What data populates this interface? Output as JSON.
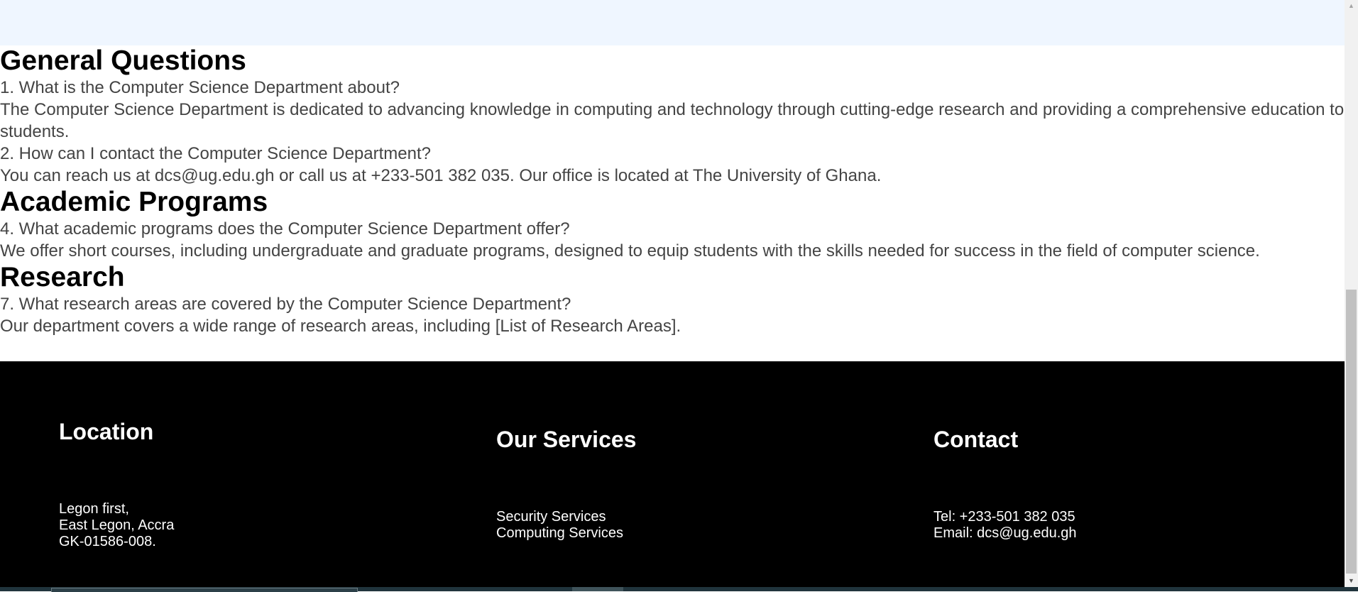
{
  "faq": {
    "sections": [
      {
        "heading": "General Questions",
        "items": [
          {
            "question": "1. What is the Computer Science Department about?",
            "answer": "The Computer Science Department is dedicated to advancing knowledge in computing and technology through cutting-edge research and providing a comprehensive education to students."
          },
          {
            "question": "2. How can I contact the Computer Science Department?",
            "answer": "You can reach us at dcs@ug.edu.gh or call us at +233-501 382 035. Our office is located at The University of Ghana."
          }
        ]
      },
      {
        "heading": "Academic Programs",
        "items": [
          {
            "question": "4. What academic programs does the Computer Science Department offer?",
            "answer": "We offer short courses, including undergraduate and graduate programs, designed to equip students with the skills needed for success in the field of computer science."
          }
        ]
      },
      {
        "heading": "Research",
        "items": [
          {
            "question": "7. What research areas are covered by the Computer Science Department?",
            "answer": "Our department covers a wide range of research areas, including [List of Research Areas]."
          }
        ]
      }
    ]
  },
  "footer": {
    "location": {
      "heading": "Location",
      "lines": [
        "Legon first,",
        "East Legon, Accra",
        "GK-01586-008."
      ]
    },
    "services": {
      "heading": "Our Services",
      "lines": [
        "Security Services",
        "Computing Services"
      ]
    },
    "contact": {
      "heading": "Contact",
      "lines": [
        "Tel: +233-501 382 035",
        "Email: dcs@ug.edu.gh"
      ]
    }
  },
  "scrollbar": {
    "up_arrow": "▲",
    "down_arrow": "▼",
    "thumb_icon": "scroll-thumb",
    "scroll_position_fraction": 1.0
  },
  "colors": {
    "top_band": "#eff6ff",
    "body_text": "#444444",
    "heading_text": "#000000",
    "footer_bg": "#000000",
    "footer_text": "#ffffff",
    "taskbar_bg": "#20343c"
  }
}
